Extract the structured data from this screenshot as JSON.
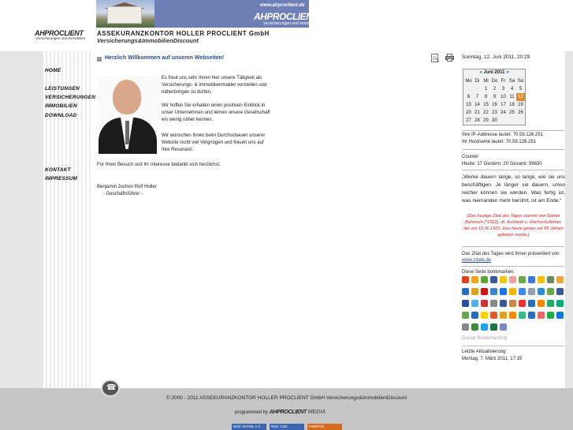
{
  "header": {
    "url": "www.ahproclient.de",
    "brand": "AHPROCLIENT",
    "brand_sub": "Versicherungen und Immobilien",
    "left_logo": "AHPROCLIENT",
    "left_logo_sub": "Versicherungen und Immobilien",
    "company": "ASSEKURANZKONTOR HOLLER PROCLIENT GmbH",
    "company_sub": "Versicherungs&ImmobilienDiscount"
  },
  "nav": {
    "home": "HOME",
    "leistungen": "LEISTUNGEN",
    "versicherungen": "VERSICHERUNGEN",
    "immobilien": "IMMOBILIEN",
    "download": "DOWNLOAD",
    "kontakt": "KONTAKT",
    "impressum": "IMPRESSUM"
  },
  "main": {
    "welcome": "Herzlich Willkommen auf unseren Webseiten!",
    "p1_lines": [
      "Es freut uns sehr Ihnen hier unsere Tätigkeit als",
      "Versicherungs- & Immobilienmakler vorstellen und",
      "näherbringen zu dürfen."
    ],
    "p2_lines": [
      "Wir hoffen Sie erhalten einen positiven Einblick in",
      "unser Unternehmen und lernen unsere Gesellschaft",
      "ein wenig näher kennen."
    ],
    "p3_lines": [
      "Wir wünschen Ihnen beim Durchschauen unserer",
      "Website recht viel Vergnügen und freuen uns auf",
      "Ihre Resonanz."
    ],
    "thanks": "Für Ihren Besuch und Ihr Interesse bedankt sich herzlichst,",
    "sign_name": "Benjamin Jochen Rolf Holler",
    "sign_title": "- Geschäftsführer -"
  },
  "sidebar": {
    "datetime": "Sonntag, 12. Juni 2011, 20:29",
    "calendar": {
      "prev": "«",
      "next": "»",
      "month": "Juni 2011",
      "weekdays": [
        "Mo",
        "Di",
        "Mi",
        "Do",
        "Fr",
        "Sa",
        "So"
      ],
      "days": [
        "",
        "",
        "1",
        "2",
        "3",
        "4",
        "5",
        "6",
        "7",
        "8",
        "9",
        "10",
        "11",
        "12",
        "13",
        "14",
        "15",
        "16",
        "17",
        "18",
        "19",
        "20",
        "21",
        "22",
        "23",
        "24",
        "25",
        "26",
        "27",
        "28",
        "29",
        "30",
        "",
        "",
        ""
      ],
      "today": "12"
    },
    "ip_line1": "Ihre IP-Addresse lautet: 70.59.126.251",
    "ip_line2": "Ihr Hostname lautet: 70.59.126.251",
    "counter_label": "Counter",
    "counter_values": "Heute: 17 Gestern: 20 Gesamt: 58630",
    "quote": "„Werke dauern lange, so lange, wie sie uns beschäftigen. Je länger sie dauern, umso reicher können sie werden. Was fertig ist, was niemanden mehr berührt, ist am Ende.“",
    "quote_source": "(Das heutige Zitat des Tages stammt von Günter Behnisch (*1922), dt. Architekt u. Hochschullehrer, der am 12.06.1922, also heute genau vor 89 Jahren geboren wurde.)",
    "zitat_text": "Das Zitat des Tages wird Ihnen präsentiert von",
    "zitat_link": "www.zitate.de",
    "bookmarks_label": "Diese Seite bookmarken:",
    "social_bookmarking": "Social Bookmarking",
    "last_update_label": "Letzte Aktualisierung:",
    "last_update_value": "Montag, 7. März 2011, 17:15"
  },
  "footer": {
    "copyright": "© 2000 - 2011 ASSEKURANZKONTOR HOLLER PROCLIENT GmbH Versicherungs&ImmobilienDiscount",
    "programmed_by": "programmed by",
    "programmed_brand": "AHPROCLIENT",
    "programmed_media": "MEDIA",
    "badges": [
      "W3C XHTML 1.0",
      "W3C CSS",
      "FIREFOX"
    ]
  },
  "bookmark_colors": [
    "#e0401c",
    "#f7a51d",
    "#5fa33d",
    "#3b5998",
    "#f3c515",
    "#e8a2a2",
    "#6aa84f",
    "#3c78d8",
    "#fbbc05",
    "#6d8764",
    "#f2a33a",
    "#2a6ebb",
    "#e0a020",
    "#c11",
    "#3d85c6",
    "#1a73e8",
    "#f4b400",
    "#4285f4",
    "#90a0b0",
    "#2d8cd6",
    "#6aa84f",
    "#3b5998",
    "#2a4da0",
    "#55acee",
    "#cc3333",
    "#888",
    "#3b5998",
    "#c84",
    "#e33",
    "#2a6ebb",
    "#f80",
    "#2a6",
    "#0a7",
    "#6aa84f",
    "#2a6ebb",
    "#ffd400",
    "#dd5b2f",
    "#e0a020",
    "#f80",
    "#3b8",
    "#2a6ebb",
    "#e66",
    "#22aa44",
    "#1177dd",
    "#888",
    "#3b8a3b",
    "#1da1f2",
    "#217346",
    "#7a88c8"
  ]
}
